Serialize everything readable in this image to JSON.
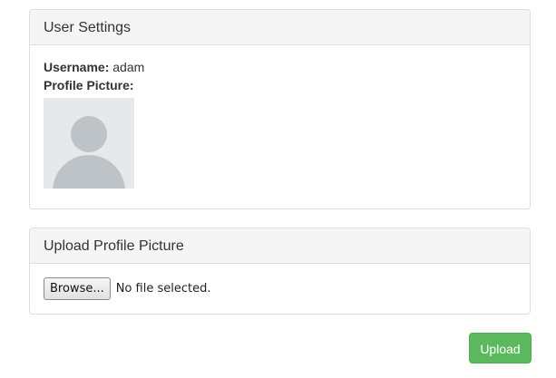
{
  "settings_panel": {
    "title": "User Settings",
    "username_label": "Username:",
    "username_value": "adam",
    "picture_label": "Profile Picture:",
    "avatar_icon": "user-silhouette-icon"
  },
  "upload_panel": {
    "title": "Upload Profile Picture",
    "browse_label": "Browse...",
    "file_status": "No file selected."
  },
  "actions": {
    "upload_label": "Upload",
    "upload_color": "#5cb85c"
  }
}
